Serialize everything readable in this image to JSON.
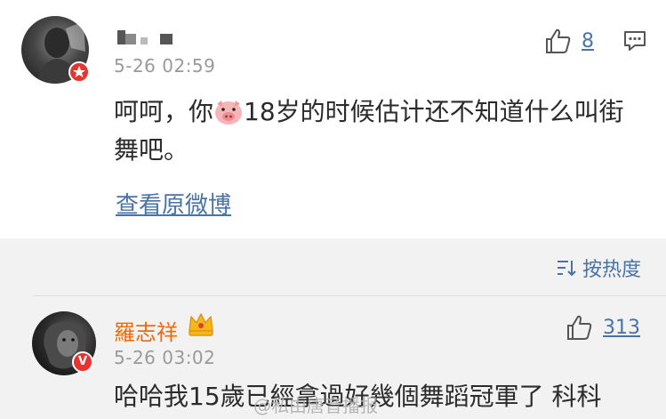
{
  "comment1": {
    "time": "5-26 02:59",
    "like_count": "8",
    "content_before": "呵呵，你",
    "content_after": "18岁的时候估计还不知道什么叫街舞吧。",
    "view_original_link": "查看原微博"
  },
  "sort": {
    "label": "按热度"
  },
  "comment2": {
    "username": "羅志祥",
    "time": "5-26 03:02",
    "like_count": "313",
    "content": "哈哈我15歲已經拿過好幾個舞蹈冠軍了 科科"
  },
  "watermark": "@私由唐音播报",
  "colors": {
    "link": "#4a73a4",
    "vip_name": "#f06a0c",
    "verified_badge": "#e8332e"
  }
}
